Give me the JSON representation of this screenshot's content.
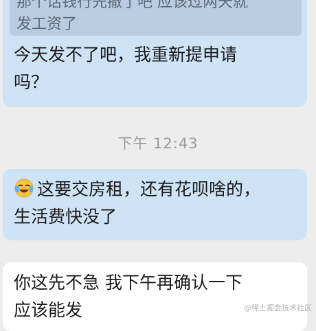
{
  "messages": {
    "quoted_line1": "那个话钱行先撤了吧 应该过两天就",
    "quoted_line2": "发工资了",
    "msg1_line1": "今天发不了吧，我重新提申请",
    "msg1_line2": "吗？",
    "timestamp": "下午 12:43",
    "msg2_emoji": "crying-laughing-emoji",
    "msg2_line1": "这要交房租，还有花呗啥的，",
    "msg2_line2": "生活费快没了",
    "msg3_line1": "你这先不急 我下午再确认一下",
    "msg3_line2": "应该能发"
  },
  "watermark": "@稀土掘金技术社区",
  "colors": {
    "background": "#ededed",
    "bubble_incoming": "#cfe3f7",
    "bubble_outgoing": "#ffffff",
    "quote_block": "#b8cde1"
  }
}
